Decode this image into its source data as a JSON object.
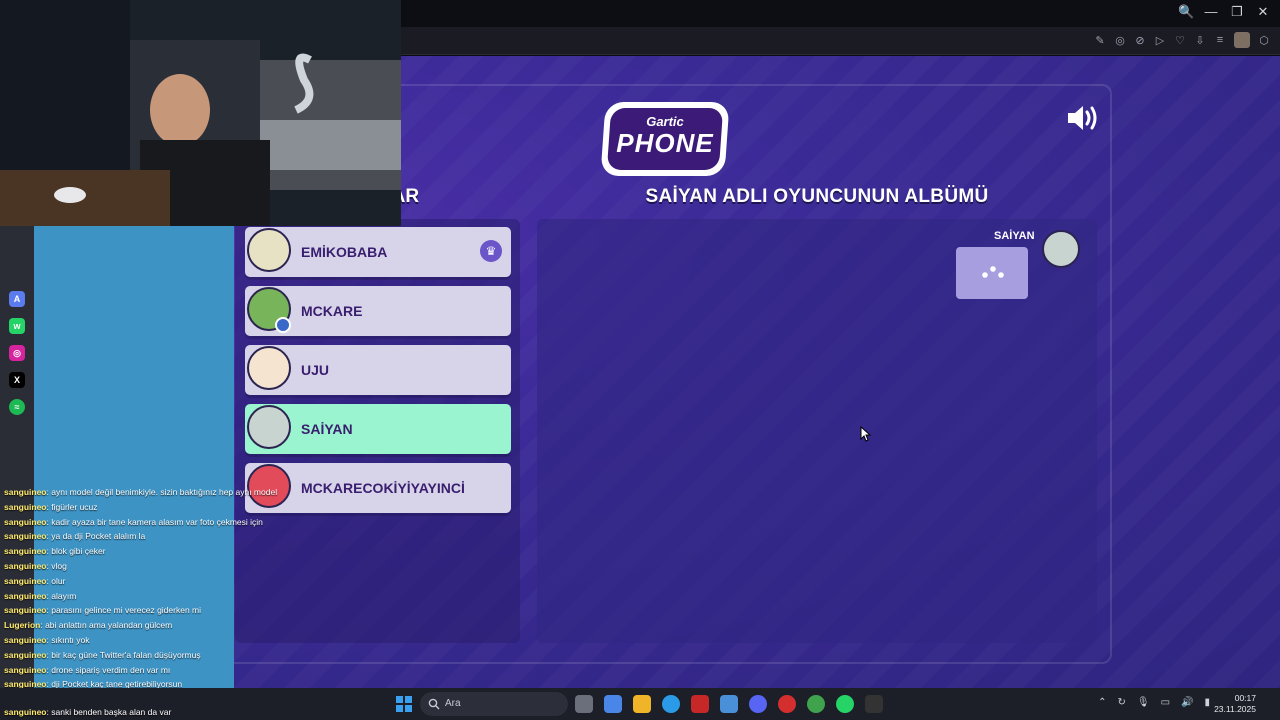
{
  "browser": {
    "window_controls": [
      "🔍",
      "—",
      "❐",
      "✕"
    ],
    "toolbar_icons": [
      "✎",
      "◎",
      "⊘",
      "▷",
      "♡",
      "⇩",
      "≡",
      "⬡"
    ]
  },
  "game": {
    "logo_top": "Gartic",
    "logo_main": "PHONE",
    "players_title": "LAR",
    "album_title": "SAİYAN ADLI OYUNCUNUN ALBÜMÜ",
    "players": [
      {
        "name": "EMİKOBABA",
        "host": true,
        "active": false,
        "avatar_color": "#e8e2c4"
      },
      {
        "name": "MCKARE",
        "host": false,
        "active": false,
        "avatar_color": "#78b45a"
      },
      {
        "name": "UJU",
        "host": false,
        "active": false,
        "avatar_color": "#f4e4d0"
      },
      {
        "name": "SAİYAN",
        "host": false,
        "active": true,
        "avatar_color": "#c7d4d0"
      },
      {
        "name": "MCKARECOKİYİYAYINCİ",
        "host": false,
        "active": false,
        "avatar_color": "#e24b5a"
      }
    ],
    "album": {
      "author": "SAİYAN"
    },
    "colors": {
      "active_row": "#9af4d0",
      "row": "#d7d4ea",
      "brand_purple": "#3b1a78"
    }
  },
  "chat": {
    "messages": [
      {
        "user": "sanguineo",
        "text": ": aynı model değil benimkiyle. sizin baktığınız hep aynı model"
      },
      {
        "user": "sanguineo",
        "text": ": figürler ucuz"
      },
      {
        "user": "sanguineo",
        "text": ": kadir ayaza bir tane kamera alasım var foto çekmesi için"
      },
      {
        "user": "sanguineo",
        "text": ": ya da dji Pocket alalım la"
      },
      {
        "user": "sanguineo",
        "text": ": blok gibi çeker"
      },
      {
        "user": "sanguineo",
        "text": ": vlog"
      },
      {
        "user": "sanguineo",
        "text": ": olur"
      },
      {
        "user": "sanguineo",
        "text": ": alayım"
      },
      {
        "user": "sanguineo",
        "text": ": parasını gelince mi verecez giderken mi"
      },
      {
        "user": "Lugerion",
        "text": ": abi anlattın ama yalandan gülcem"
      },
      {
        "user": "sanguineo",
        "text": ": sıkıntı yok"
      },
      {
        "user": "sanguineo",
        "text": ": bir kaç güne Twitter'a falan düşüyormuş"
      },
      {
        "user": "sanguineo",
        "text": ": drone sipariş verdim den var mı"
      },
      {
        "user": "sanguineo",
        "text": ": dji Pocket kaç tane getirebiliyorsun"
      },
      {
        "user": "sanguineo",
        "text": ": sanki benden başka alan da var"
      }
    ]
  },
  "taskbar": {
    "search_placeholder": "Ara",
    "time": "00:17",
    "date": "23.11.2025",
    "app_colors": [
      "#6b6f7c",
      "#4a86e8",
      "#f0b429",
      "#2b9be8",
      "#c62828",
      "#4a90d9",
      "#5865f2",
      "#d32f2f",
      "#3fa34d",
      "#25d366",
      "#333333"
    ]
  }
}
